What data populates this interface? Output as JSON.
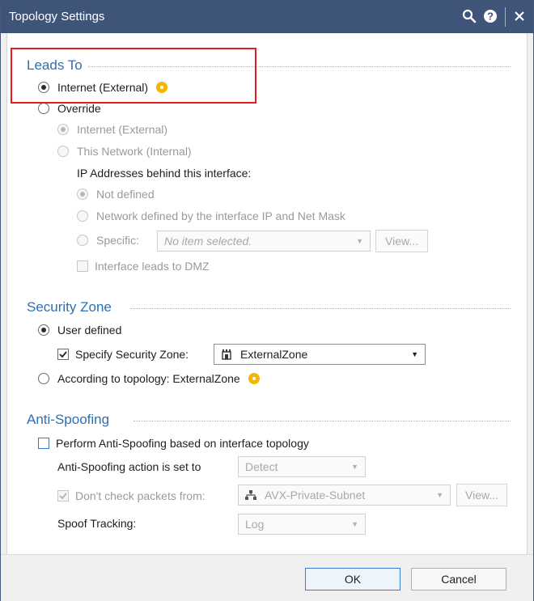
{
  "window": {
    "title": "Topology Settings"
  },
  "titlebar_icons": [
    "search-icon",
    "help-icon",
    "close-icon"
  ],
  "leads_to": {
    "section_title": "Leads To",
    "internet_external": "Internet (External)",
    "override": "Override",
    "override_internet": "Internet (External)",
    "override_this_network": "This Network (Internal)",
    "ip_behind_label": "IP Addresses behind this interface:",
    "not_defined": "Not defined",
    "network_defined": "Network defined by the interface IP and Net Mask",
    "specific_label": "Specific:",
    "specific_placeholder": "No item selected.",
    "view_button": "View...",
    "dmz_label": "Interface leads to DMZ"
  },
  "security_zone": {
    "section_title": "Security Zone",
    "user_defined": "User defined",
    "specify_label": "Specify Security Zone:",
    "zone_value": "ExternalZone",
    "according_to": "According to topology: ExternalZone"
  },
  "anti_spoofing": {
    "section_title": "Anti-Spoofing",
    "perform_label": "Perform Anti-Spoofing based on interface topology",
    "action_label": "Anti-Spoofing action is set to",
    "action_value": "Detect",
    "dont_check_label": "Don't check packets from:",
    "dont_check_value": "AVX-Private-Subnet",
    "view_button": "View...",
    "spoof_tracking_label": "Spoof Tracking:",
    "spoof_tracking_value": "Log"
  },
  "footer": {
    "ok": "OK",
    "cancel": "Cancel"
  },
  "colors": {
    "titlebar": "#3e5478",
    "section_title": "#2c6fb5",
    "highlight": "#e11d1d",
    "hint": "#f2b705"
  }
}
